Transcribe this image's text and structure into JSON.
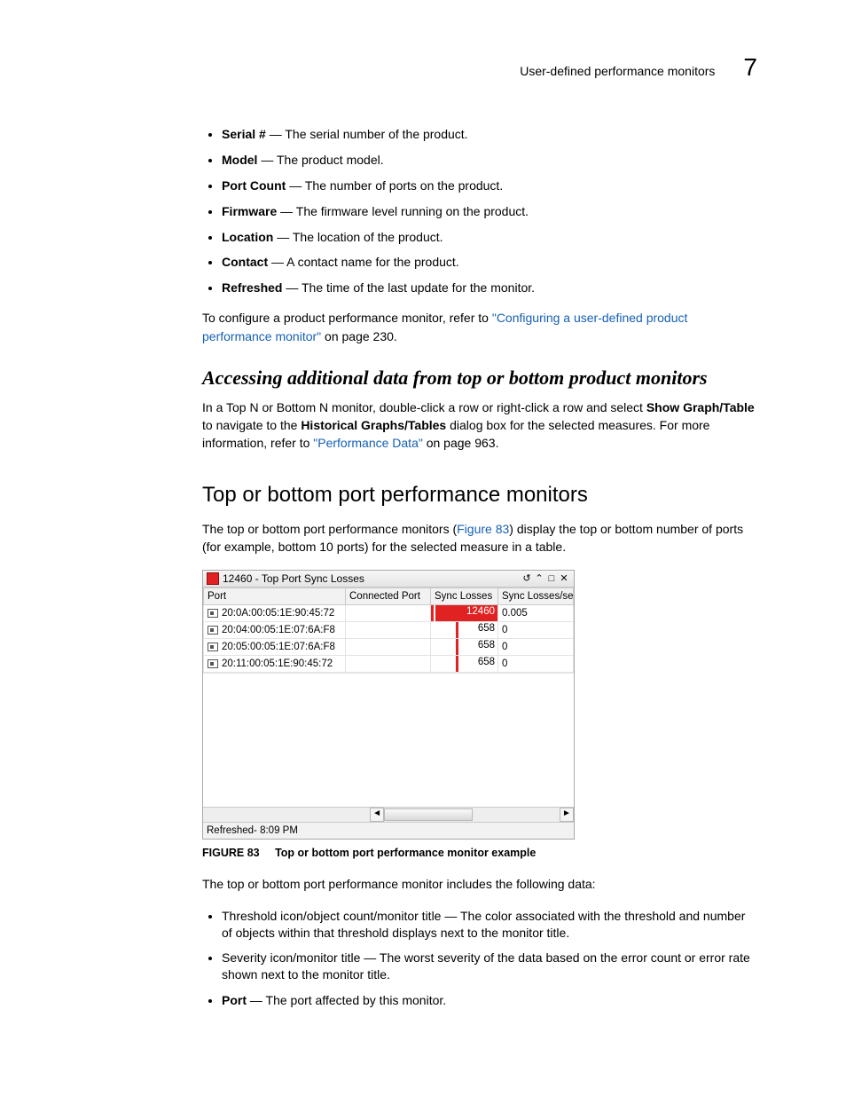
{
  "header": {
    "running_text": "User-defined performance monitors",
    "chapter_number": "7"
  },
  "defs_top": [
    {
      "term": "Serial #",
      "desc": "The serial number of the product."
    },
    {
      "term": "Model",
      "desc": "The product model."
    },
    {
      "term": "Port Count",
      "desc": "The number of ports on the product."
    },
    {
      "term": "Firmware",
      "desc": "The firmware level running on the product."
    },
    {
      "term": "Location",
      "desc": "The location of the product."
    },
    {
      "term": "Contact",
      "desc": "A contact name for the product."
    },
    {
      "term": "Refreshed",
      "desc": "The time of the last update for the monitor."
    }
  ],
  "para1": {
    "lead": "To configure a product performance monitor, refer to ",
    "link": "\"Configuring a user-defined product performance monitor\"",
    "tail": " on page 230."
  },
  "h2": "Accessing additional data from top or bottom product monitors",
  "para2": {
    "p1a": "In a Top N or Bottom N monitor, double-click a row or right-click a row and select ",
    "bold1": "Show Graph/Table",
    "p1b": " to navigate to the ",
    "bold2": "Historical Graphs/Tables",
    "p1c": " dialog box for the selected measures. For more information, refer to ",
    "link": "\"Performance Data\"",
    "p1d": " on page 963."
  },
  "h1": "Top or bottom port performance monitors",
  "para3": {
    "a": "The top or bottom port performance monitors (",
    "link": "Figure 83",
    "b": ") display the top or bottom number of ports (for example, bottom 10 ports) for the selected measure in a table."
  },
  "figure": {
    "title": "12460 - Top Port Sync Losses",
    "columns": [
      "Port",
      "Connected Port",
      "Sync Losses",
      "Sync Losses/sec"
    ],
    "rows": [
      {
        "port": "20:0A:00:05:1E:90:45:72",
        "connected": "",
        "sync": "12460",
        "hot": true,
        "rate": "0.005"
      },
      {
        "port": "20:04:00:05:1E:07:6A:F8",
        "connected": "",
        "sync": "658",
        "hot": false,
        "rate": "0"
      },
      {
        "port": "20:05:00:05:1E:07:6A:F8",
        "connected": "",
        "sync": "658",
        "hot": false,
        "rate": "0"
      },
      {
        "port": "20:11:00:05:1E:90:45:72",
        "connected": "",
        "sync": "658",
        "hot": false,
        "rate": "0"
      }
    ],
    "footer": "Refreshed- 8:09 PM"
  },
  "caption": {
    "label": "FIGURE 83",
    "text": "Top or bottom port performance monitor example"
  },
  "para4": "The top or bottom port performance monitor includes the following data:",
  "defs_bottom": [
    {
      "text": "Threshold icon/object count/monitor title — The color associated with the threshold and number of objects within that threshold displays next to the monitor title."
    },
    {
      "text": "Severity icon/monitor title — The worst severity of the data based on the error count or error rate shown next to the monitor title."
    }
  ],
  "defs_bottom_last": {
    "term": "Port",
    "desc": "The port affected by this monitor."
  }
}
